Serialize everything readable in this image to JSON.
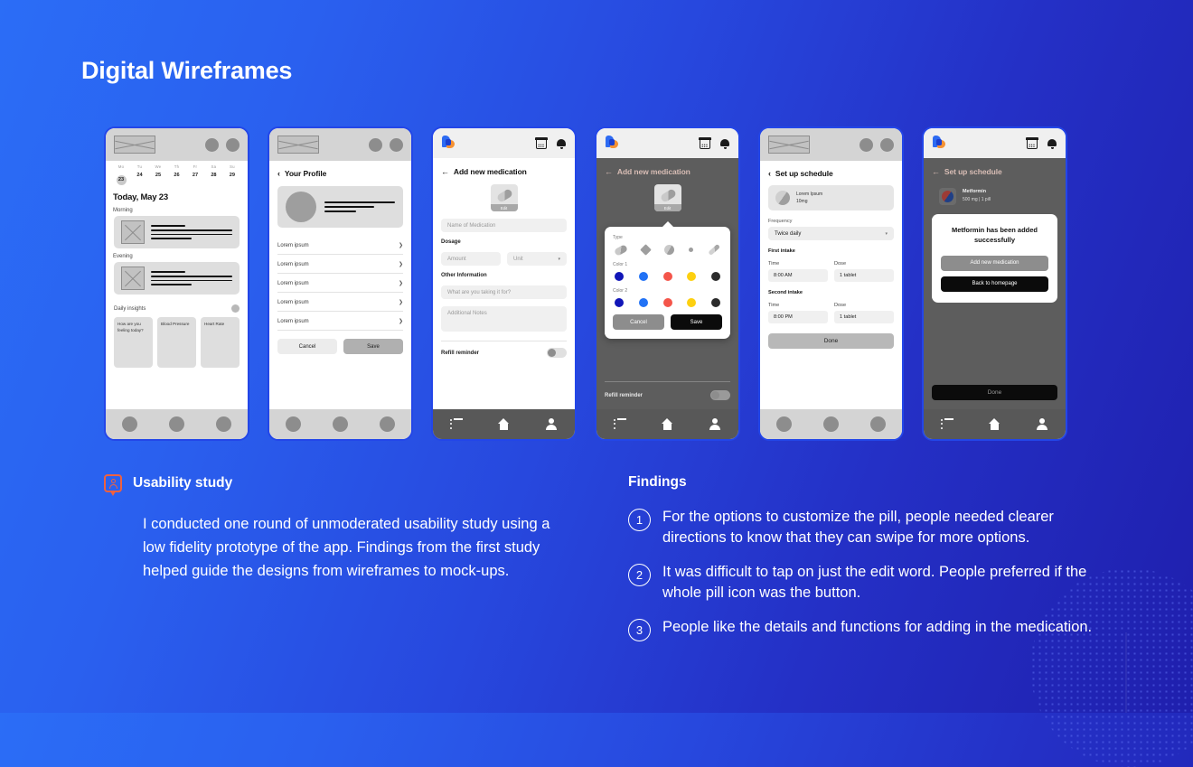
{
  "page": {
    "title": "Digital Wireframes"
  },
  "theme": {
    "gradient_start": "#2b6df6",
    "gradient_end": "#1f1fad",
    "phone_border": "#2346e8",
    "accent_orange": "#f0613f"
  },
  "phones": [
    {
      "id": "home",
      "status_bar_style": "wireframe",
      "calendar": {
        "dow": [
          "Mo",
          "Tu",
          "We",
          "Th",
          "Fr",
          "Sa",
          "Su"
        ],
        "days": [
          "23",
          "24",
          "25",
          "26",
          "27",
          "28",
          "29"
        ],
        "selected_index": 0
      },
      "today_label": "Today, May 23",
      "sections": [
        {
          "label": "Morning"
        },
        {
          "label": "Evening"
        }
      ],
      "insights_label": "Daily insights",
      "insight_cards": [
        "How are you feeling today?",
        "Blood Pressure",
        "Heart Rate"
      ],
      "bottom_bar_style": "wireframe"
    },
    {
      "id": "profile",
      "status_bar_style": "wireframe",
      "title": "Your Profile",
      "back_icon": "chevron-left-icon",
      "list_items": [
        "Lorem ipsum",
        "Lorem ipsum",
        "Lorem ipsum",
        "Lorem ipsum",
        "Lorem ipsum"
      ],
      "buttons": {
        "cancel": "Cancel",
        "save": "Save"
      },
      "bottom_bar_style": "wireframe"
    },
    {
      "id": "add-medication",
      "status_bar_style": "app",
      "title": "Add new medication",
      "back_icon": "arrow-left-icon",
      "pill_edit_label": "Edit",
      "fields": {
        "name_placeholder": "Name of Medication",
        "dosage_label": "Dosage",
        "amount_placeholder": "Amount",
        "unit_placeholder": "Unit",
        "other_info_label": "Other Information",
        "purpose_placeholder": "What are you taking it for?",
        "notes_placeholder": "Additional Notes"
      },
      "refill_label": "Refill reminder",
      "bottom_bar_style": "app"
    },
    {
      "id": "add-medication-customize",
      "status_bar_style": "app",
      "title": "Add new medication",
      "back_icon": "arrow-left-icon",
      "pill_edit_label": "Edit",
      "popup": {
        "type_label": "Type",
        "types": [
          "capsule",
          "diamond",
          "round",
          "dot",
          "thin-capsule"
        ],
        "color1_label": "Color 1",
        "color2_label": "Color 2",
        "colors": [
          "#1116b8",
          "#2272f5",
          "#f4554a",
          "#fdd010",
          "#2b2b2b"
        ],
        "cancel": "Cancel",
        "save": "Save"
      },
      "refill_label": "Refill reminder",
      "bottom_bar_style": "app"
    },
    {
      "id": "set-up-schedule",
      "status_bar_style": "wireframe",
      "title": "Set up schedule",
      "back_icon": "chevron-left-icon",
      "med": {
        "name": "Lorem Ipsum",
        "dose": "10mg"
      },
      "frequency_label": "Frequency",
      "frequency_value": "Twice daily",
      "intakes": [
        {
          "heading": "First intake",
          "time_label": "Time",
          "time_value": "8:00 AM",
          "dose_label": "Dose",
          "dose_value": "1 tablet"
        },
        {
          "heading": "Second intake",
          "time_label": "Time",
          "time_value": "8:00 PM",
          "dose_label": "Dose",
          "dose_value": "1 tablet"
        }
      ],
      "done_label": "Done",
      "bottom_bar_style": "wireframe"
    },
    {
      "id": "set-up-schedule-success",
      "status_bar_style": "app",
      "title": "Set up schedule",
      "back_icon": "arrow-left-icon",
      "med": {
        "name": "Metformin",
        "dose": "500 mg  |  1 pill"
      },
      "modal": {
        "title": "Metformin has been added successfully",
        "primary": "Add new medication",
        "secondary": "Back to homepage"
      },
      "done_label": "Done",
      "bottom_bar_style": "app"
    }
  ],
  "usability": {
    "heading": "Usability study",
    "icon": "user-feedback-badge-icon",
    "body": "I conducted one round of unmoderated usability study using a low fidelity prototype of the app. Findings from the first study helped guide the designs from wireframes to mock-ups."
  },
  "findings": {
    "heading": "Findings",
    "items": [
      {
        "num": "1",
        "text": "For the options to customize the pill, people needed clearer directions to know that they can swipe for more options."
      },
      {
        "num": "2",
        "text": "It was difficult to tap on just the edit word. People preferred if the whole pill icon was the button."
      },
      {
        "num": "3",
        "text": "People like the details and functions for adding in the medication."
      }
    ]
  }
}
